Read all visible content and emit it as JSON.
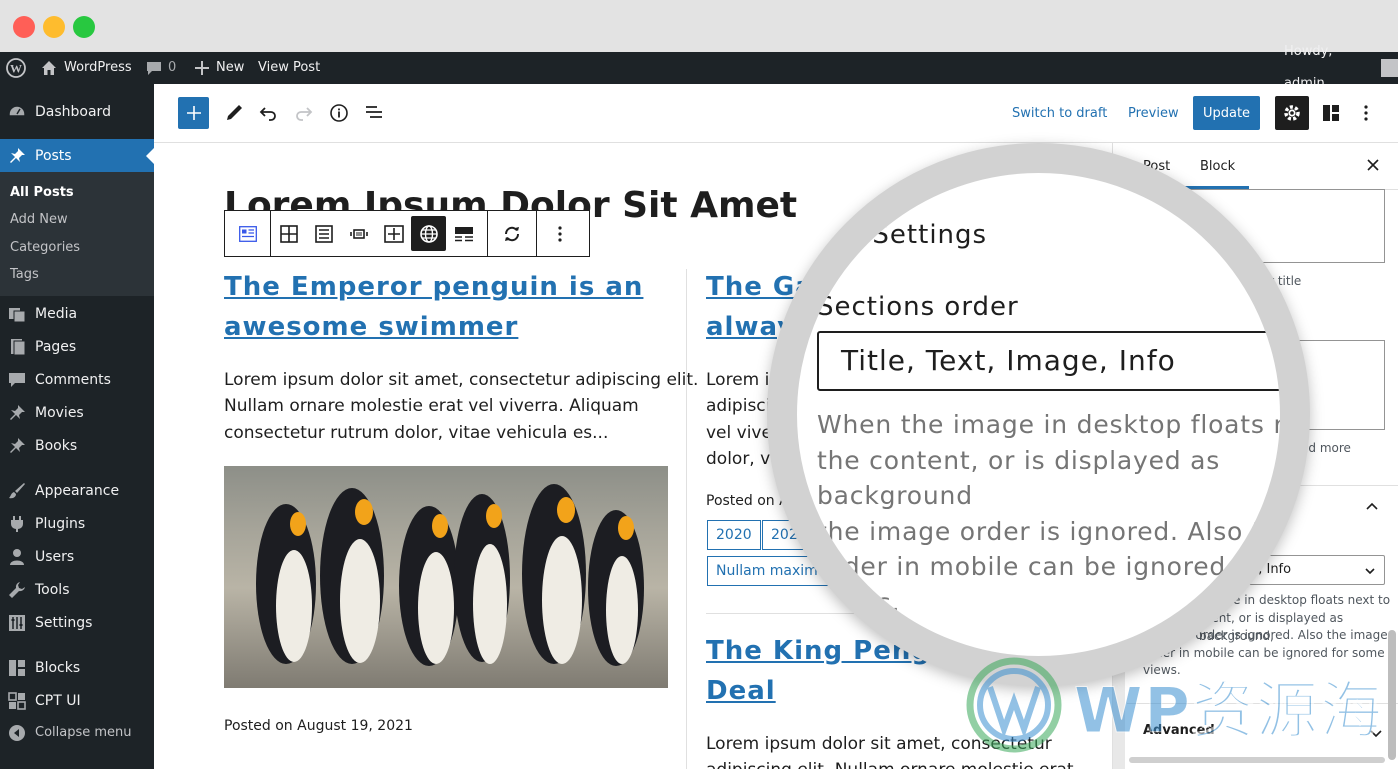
{
  "adminbar": {
    "site_name": "WordPress",
    "comments_count": "0",
    "new_label": "New",
    "view_post": "View Post",
    "howdy": "Howdy, admin"
  },
  "sidebar": {
    "dashboard": "Dashboard",
    "posts": "Posts",
    "sub": [
      "All Posts",
      "Add New",
      "Categories",
      "Tags"
    ],
    "items": [
      "Media",
      "Pages",
      "Comments",
      "Movies",
      "Books",
      "Appearance",
      "Plugins",
      "Users",
      "Tools",
      "Settings",
      "Blocks",
      "CPT UI",
      "Collapse menu"
    ]
  },
  "toolbar": {
    "switch_draft": "Switch to draft",
    "preview": "Preview",
    "update": "Update"
  },
  "editor": {
    "title": "Lorem Ipsum Dolor Sit Amet",
    "post1": {
      "heading_l1": "The Emperor penguin is an",
      "heading_l2": "awesome swimmer",
      "excerpt": [
        "Lorem ipsum dolor sit amet, consectetur adipiscing elit.",
        "Nullam ornare molestie erat vel viverra. Aliquam",
        "consectetur rutrum dolor, vitae vehicula es..."
      ],
      "posted": "Posted on August 19, 2021"
    },
    "post2": {
      "heading_l1": "The Gala",
      "heading_l2": "always",
      "excerpt": [
        "Lorem ips",
        "adipiscing",
        "vel viverra",
        "dolor, vitae"
      ],
      "posted": "Posted on Aug",
      "tags": [
        "2020",
        "2021",
        "Nullam maximus"
      ]
    },
    "post3": {
      "heading_l1": "The King Penguin is a",
      "heading_l2": "Deal",
      "excerpt": [
        "Lorem ipsum dolor sit amet, consectetur",
        "adipiscing elit. Nullam ornare molestie erat"
      ]
    }
  },
  "panel": {
    "tab_post": "Post",
    "tab_block": "Block",
    "after_title": "fter title",
    "read_more": "read more",
    "select_value": "age, Info",
    "help": [
      "image in desktop floats next to",
      "ntent, or is displayed as background,",
      "e image order is ignored. Also the image",
      "order in mobile can be ignored for some",
      "views."
    ],
    "advanced": "Advanced"
  },
  "magnifier": {
    "settings_title": "uer Settings",
    "sections_label": "Sections order",
    "select_value": "Title, Text, Image, Info",
    "help": [
      "When the image in desktop floats next to",
      "the content, or is displayed as background",
      "the image order is ignored. Also the imag",
      "order in mobile can be ignored for some",
      "views."
    ]
  },
  "watermark": {
    "text": "WP资源海"
  },
  "colors": {
    "accent": "#2271b1",
    "admin_bg": "#1d2327",
    "submenu_bg": "#2c3338"
  }
}
